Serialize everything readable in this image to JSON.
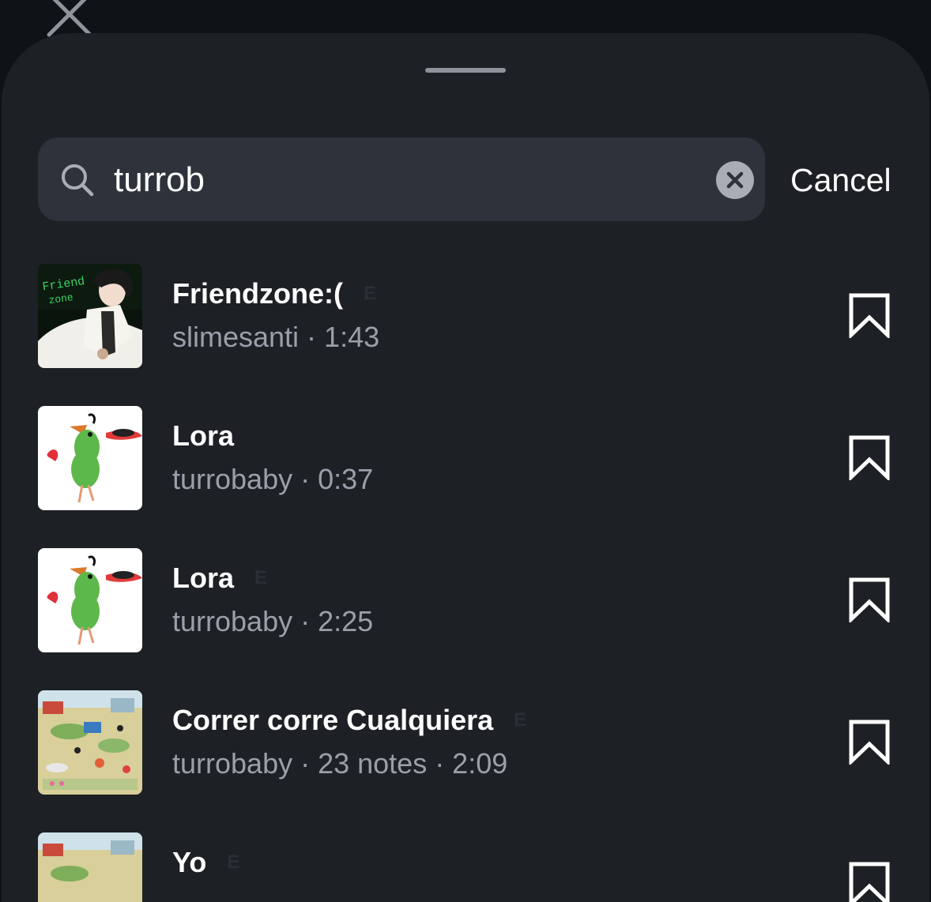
{
  "search": {
    "query": "turrob",
    "cancel_label": "Cancel"
  },
  "results": [
    {
      "title": "Friendzone:(",
      "explicit": "E",
      "artist": "slimesanti",
      "extra": "",
      "duration": "1:43",
      "meta": "slimesanti · 1:43",
      "art": "friendzone"
    },
    {
      "title": "Lora",
      "explicit": "",
      "artist": "turrobaby",
      "extra": "",
      "duration": "0:37",
      "meta": "turrobaby · 0:37",
      "art": "parrot"
    },
    {
      "title": "Lora",
      "explicit": "E",
      "artist": "turrobaby",
      "extra": "",
      "duration": "2:25",
      "meta": "turrobaby · 2:25",
      "art": "parrot"
    },
    {
      "title": "Correr corre Cualquiera",
      "explicit": "E",
      "artist": "turrobaby",
      "extra": "23 notes",
      "duration": "2:09",
      "meta": "turrobaby · 23 notes · 2:09",
      "art": "collage"
    },
    {
      "title": "Yo",
      "explicit": "E",
      "artist": "",
      "extra": "",
      "duration": "",
      "meta": "",
      "art": "collage"
    }
  ],
  "icons": {
    "background_close": "close-icon",
    "search": "search-icon",
    "clear": "clear-icon",
    "save": "bookmark-icon"
  },
  "colors": {
    "page_background": "#0f1318",
    "sheet_background": "#1d2025",
    "search_background": "#2d323b",
    "secondary_text": "#9aa0aa"
  }
}
